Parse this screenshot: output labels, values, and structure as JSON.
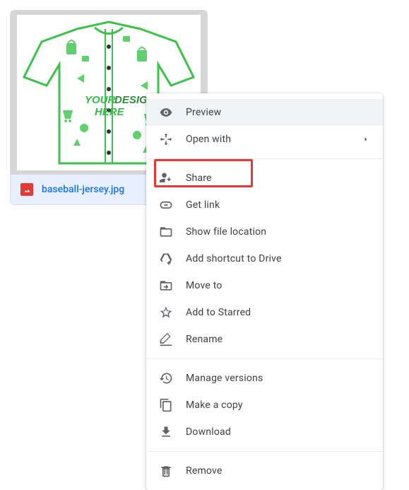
{
  "file": {
    "name": "baseball-jersey.jpg",
    "thumb_text_line1": "YOUR DESIGN",
    "thumb_text_line2": "HERE"
  },
  "menu": {
    "preview": "Preview",
    "open_with": "Open with",
    "share": "Share",
    "get_link": "Get link",
    "show_file_location": "Show file location",
    "add_shortcut": "Add shortcut to Drive",
    "move_to": "Move to",
    "add_starred": "Add to Starred",
    "rename": "Rename",
    "manage_versions": "Manage versions",
    "make_copy": "Make a copy",
    "download": "Download",
    "remove": "Remove"
  },
  "highlighted_item": "share"
}
